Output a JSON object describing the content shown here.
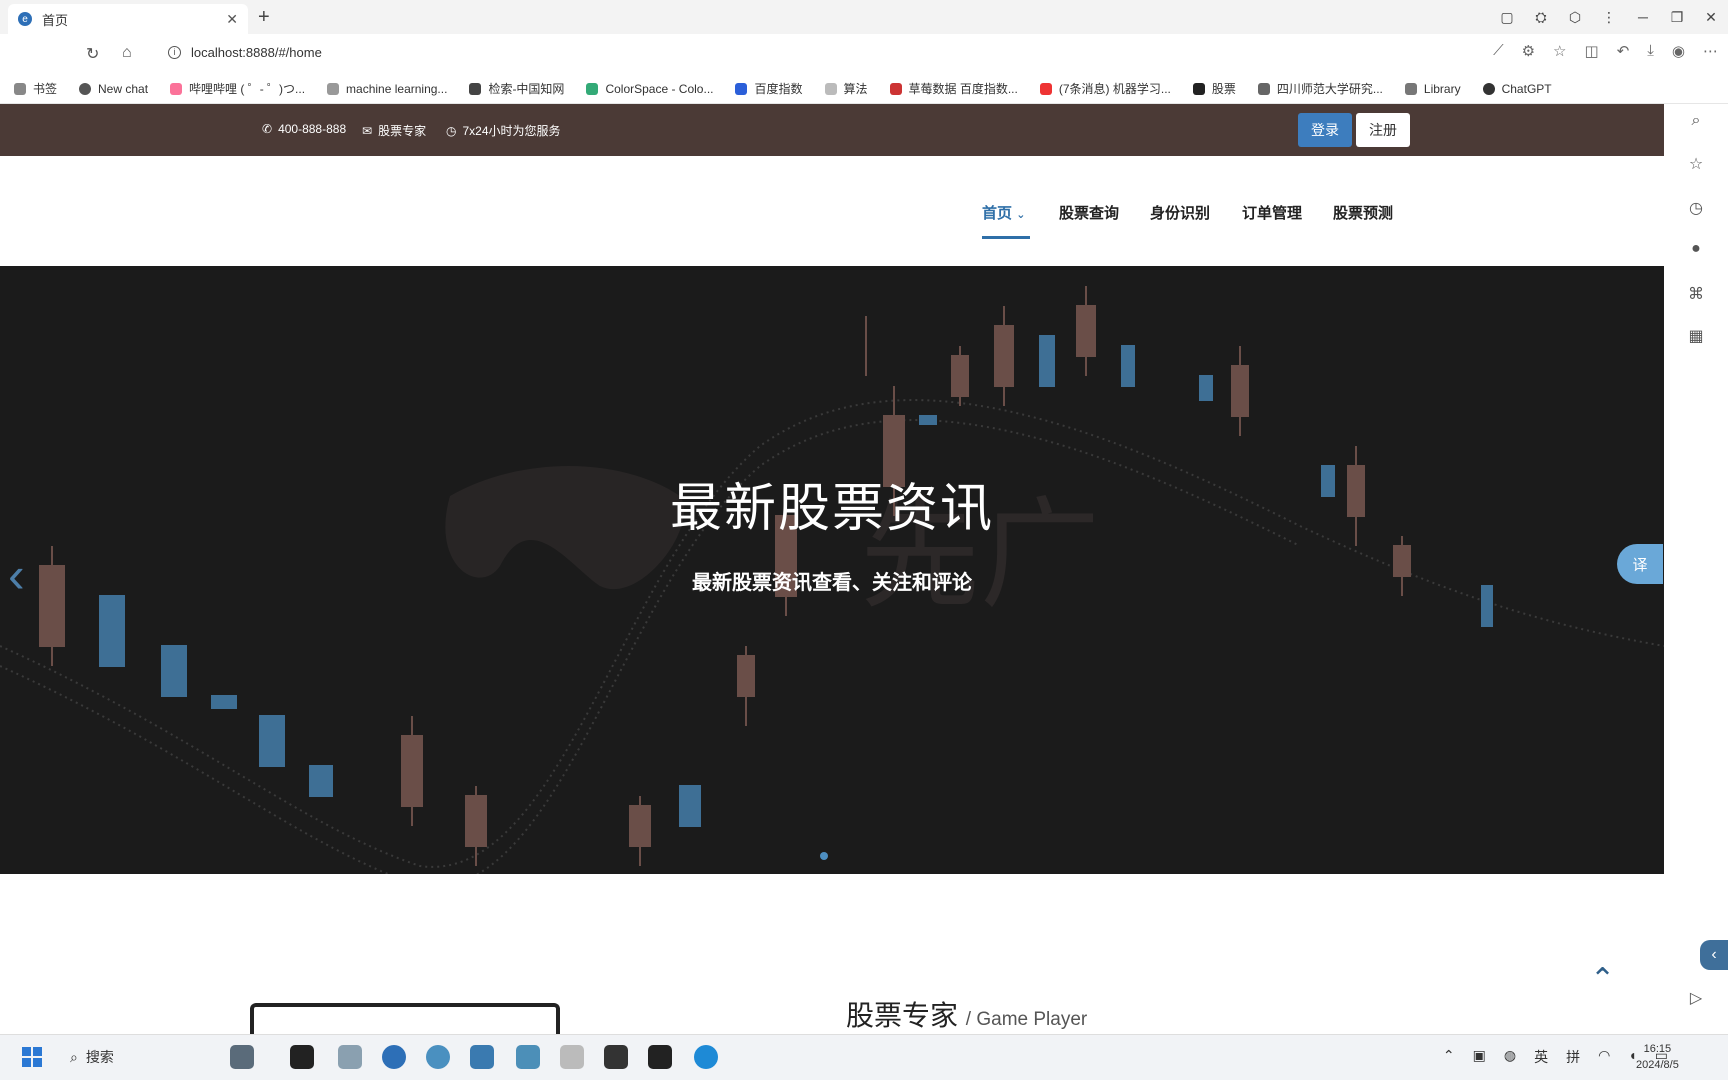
{
  "browser": {
    "tab_title": "首页",
    "url": "localhost:8888/#/home",
    "bookmarks": [
      "书签",
      "New chat",
      "哔哩哔哩 ( ゜- ゜)つ...",
      "machine learning...",
      "检索-中国知网",
      "ColorSpace - Colo...",
      "百度指数",
      "算法",
      "草莓数据 百度指数...",
      "(7条消息) 机器学习...",
      "股票",
      "四川师范大学研究...",
      "Library",
      "ChatGPT"
    ]
  },
  "topbar": {
    "phone": "400-888-888",
    "brand": "股票专家",
    "service": "7x24小时为您服务",
    "login": "登录",
    "register": "注册"
  },
  "nav": {
    "items": [
      "首页",
      "股票查询",
      "身份识别",
      "订单管理",
      "股票预测"
    ]
  },
  "hero": {
    "title": "最新股票资讯",
    "subtitle": "最新股票资讯查看、关注和评论",
    "translate": "译"
  },
  "section": {
    "title": "股票专家",
    "subtitle": "/ Game Player"
  },
  "taskbar": {
    "search": "搜索",
    "ime1": "英",
    "ime2": "拼",
    "time": "16:15",
    "date": "2024/8/5"
  }
}
